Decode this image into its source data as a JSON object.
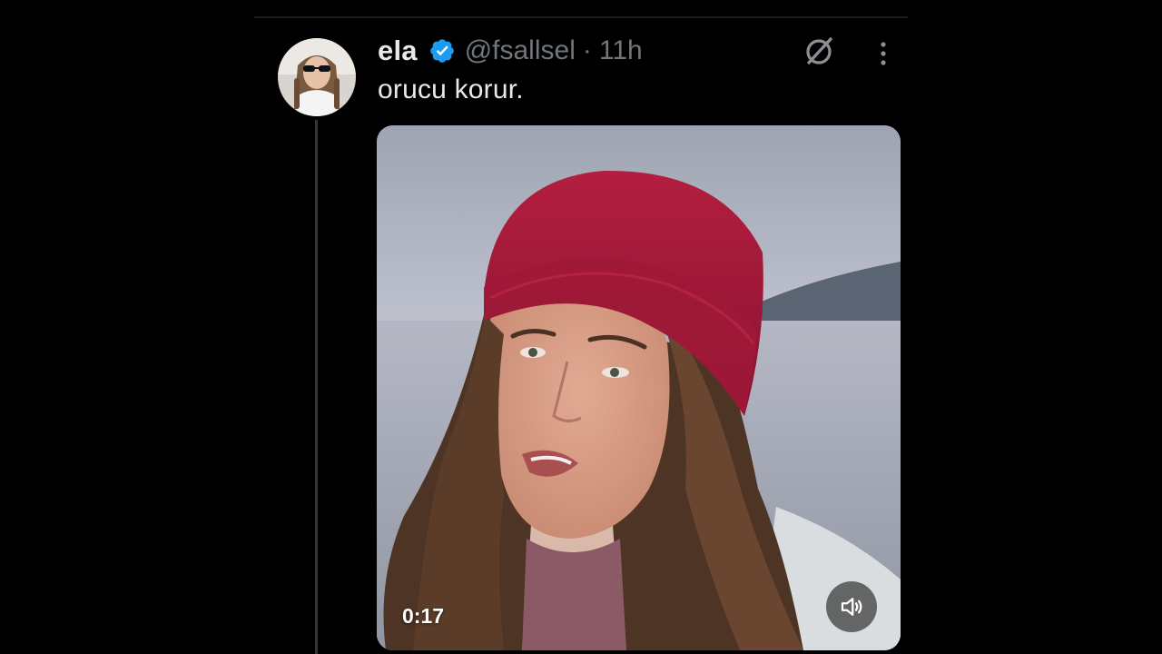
{
  "tweet": {
    "display_name": "ela",
    "handle": "@fsallsel",
    "separator": "·",
    "time": "11h",
    "text": "orucu korur.",
    "verified": true
  },
  "media": {
    "type": "video",
    "duration": "0:17",
    "muted": true
  },
  "icons": {
    "verified": "verified-badge-icon",
    "grok": "grok-icon",
    "more": "more-vertical-icon",
    "volume": "speaker-muted-icon"
  },
  "colors": {
    "background": "#000000",
    "primary_text": "#e7e9ea",
    "secondary_text": "#71767b",
    "verified_blue": "#1d9bf0",
    "thread_line": "#333639"
  }
}
